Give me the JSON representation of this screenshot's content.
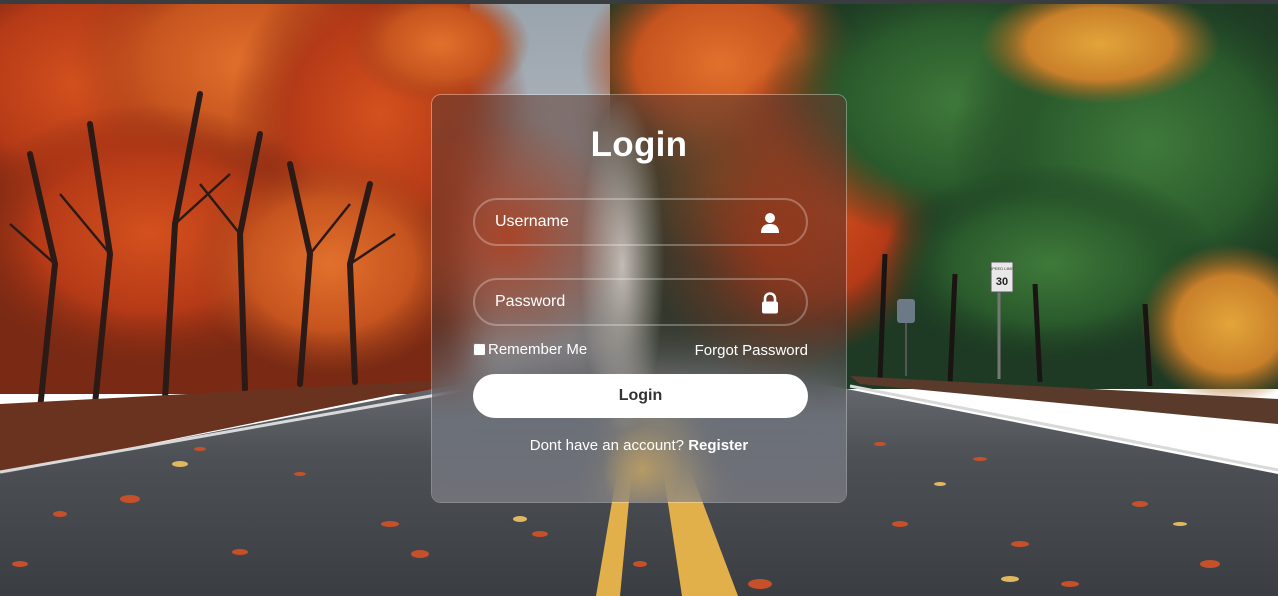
{
  "login_form": {
    "title": "Login",
    "username": {
      "placeholder": "Username",
      "icon": "user-icon"
    },
    "password": {
      "placeholder": "Password",
      "icon": "lock-icon"
    },
    "remember_label": "Remember Me",
    "remember_checked": false,
    "forgot_label": "Forgot Password",
    "submit_label": "Login",
    "register_prompt": "Dont have an account?",
    "register_link": "Register"
  },
  "background": {
    "sign_text_top": "SPEED LIMIT",
    "sign_text_value": "30"
  },
  "colors": {
    "button_bg": "#ffffff",
    "button_text": "#333333",
    "text": "#ffffff"
  }
}
